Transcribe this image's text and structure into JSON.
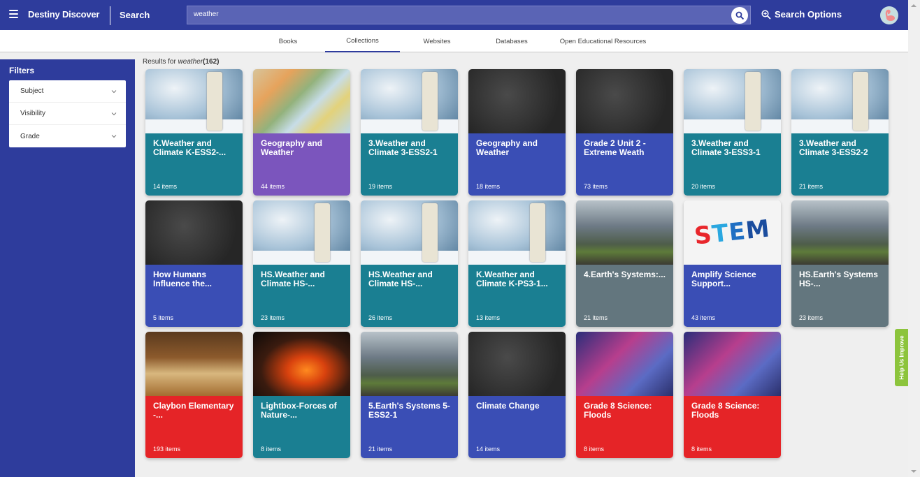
{
  "header": {
    "menu_icon": "hamburger-icon",
    "brand": "Destiny Discover",
    "page": "Search",
    "search": {
      "value": "weather",
      "placeholder": ""
    },
    "search_icon": "search-icon",
    "search_options_label": "Search Options",
    "search_options_icon": "zoom-in-icon",
    "avatar_icon": "flamingo-avatar"
  },
  "tabs": [
    {
      "label": "Books",
      "active": false
    },
    {
      "label": "Collections",
      "active": true
    },
    {
      "label": "Websites",
      "active": false
    },
    {
      "label": "Databases",
      "active": false
    },
    {
      "label": "Open Educational Resources",
      "active": false
    }
  ],
  "sidebar": {
    "title": "Filters",
    "filters": [
      {
        "label": "Subject"
      },
      {
        "label": "Visibility"
      },
      {
        "label": "Grade"
      }
    ]
  },
  "results": {
    "prefix": "Results for",
    "query": "weather",
    "count": "(162)"
  },
  "colors": {
    "brand": "#2e3c9c",
    "teal": "#1a7f92",
    "purple": "#7b55bd",
    "blue": "#3a4eb5",
    "slate": "#63767e",
    "red": "#e52427",
    "help_green": "#8cc43c"
  },
  "collections": [
    {
      "title": "K.Weather and Climate K-ESS2-...",
      "count": "14 items",
      "color": "teal",
      "image": "thermometer"
    },
    {
      "title": "Geography and Weather",
      "count": "44 items",
      "color": "purple",
      "image": "map"
    },
    {
      "title": "3.Weather and Climate 3-ESS2-1",
      "count": "19 items",
      "color": "teal",
      "image": "thermometer"
    },
    {
      "title": "Geography and Weather",
      "count": "18 items",
      "color": "blue",
      "image": "chalkboard"
    },
    {
      "title": "Grade 2 Unit 2 - Extreme Weath",
      "count": "73 items",
      "color": "blue",
      "image": "chalkboard"
    },
    {
      "title": "3.Weather and Climate 3-ESS3-1",
      "count": "20 items",
      "color": "teal",
      "image": "thermometer"
    },
    {
      "title": "3.Weather and Climate 3-ESS2-2",
      "count": "21 items",
      "color": "teal",
      "image": "thermometer"
    },
    {
      "title": "How Humans Influence the...",
      "count": "5 items",
      "color": "blue",
      "image": "chalkboard"
    },
    {
      "title": "HS.Weather and Climate HS-...",
      "count": "23 items",
      "color": "teal",
      "image": "thermometer"
    },
    {
      "title": "HS.Weather and Climate HS-...",
      "count": "26 items",
      "color": "teal",
      "image": "thermometer"
    },
    {
      "title": "K.Weather and Climate K-PS3-1...",
      "count": "13 items",
      "color": "teal",
      "image": "thermometer"
    },
    {
      "title": "4.Earth's Systems:...",
      "count": "21 items",
      "color": "slate",
      "image": "landscape"
    },
    {
      "title": "Amplify Science Support...",
      "count": "43 items",
      "color": "blue",
      "image": "stem"
    },
    {
      "title": "HS.Earth's Systems HS-...",
      "count": "23 items",
      "color": "slate",
      "image": "landscape"
    },
    {
      "title": "Claybon Elementary -...",
      "count": "193 items",
      "color": "red",
      "image": "books"
    },
    {
      "title": "Lightbox-Forces of Nature-...",
      "count": "8 items",
      "color": "teal",
      "image": "volcano"
    },
    {
      "title": "5.Earth's Systems 5-ESS2-1",
      "count": "21 items",
      "color": "blue",
      "image": "landscape"
    },
    {
      "title": "Climate Change",
      "count": "14 items",
      "color": "blue",
      "image": "chalkboard"
    },
    {
      "title": "Grade 8 Science: Floods",
      "count": "8 items",
      "color": "red",
      "image": "lab"
    },
    {
      "title": "Grade 8 Science: Floods",
      "count": "8 items",
      "color": "red",
      "image": "lab"
    }
  ],
  "stem_text": "STEM",
  "help_tab": "Help Us Improve"
}
